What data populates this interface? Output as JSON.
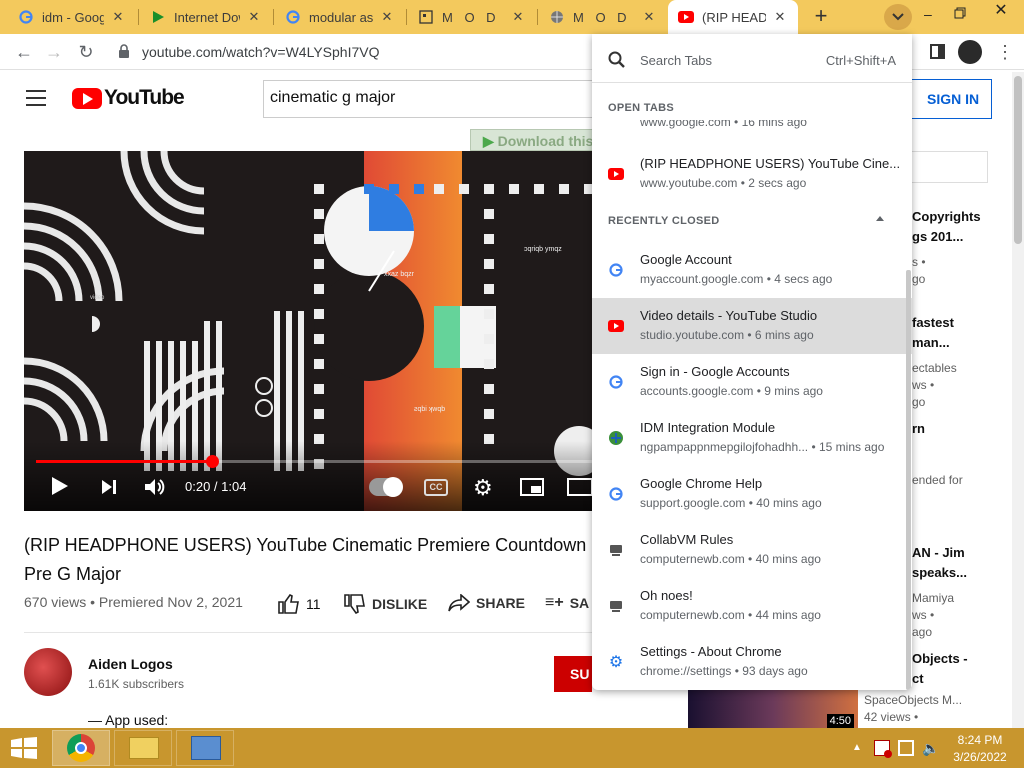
{
  "browser": {
    "tabs": [
      {
        "title": "idm - Googl",
        "icon": "google-icon"
      },
      {
        "title": "Internet Dow",
        "icon": "green-play-icon"
      },
      {
        "title": "modular ash",
        "icon": "google-icon"
      },
      {
        "title": "M O D U L A",
        "icon": "modular-icon"
      },
      {
        "title": "M O D U L A",
        "icon": "globe-icon"
      },
      {
        "title": "(RIP HEADPH",
        "icon": "youtube-icon"
      }
    ],
    "new_tab": "+",
    "url": "youtube.com/watch?v=W4LYSphI7VQ"
  },
  "youtube": {
    "logo": "YouTube",
    "search_value": "cinematic g major",
    "sign_in": "SIGN IN",
    "download_badge": "Download this",
    "player": {
      "time": "0:20 / 1:04",
      "progress": 0.31
    },
    "video_title": "(RIP HEADPHONE USERS) YouTube Cinematic Premiere Countdown Pre G Major",
    "views": "670 views • Premiered Nov 2, 2021",
    "likes": "11",
    "dislike": "DISLIKE",
    "share": "SHARE",
    "save": "SA",
    "channel": "Aiden Logos",
    "subscribers": "1.61K subscribers",
    "subscribe": "SU",
    "desc_line": "— App used:",
    "art_text": [
      "xxaz bqzr",
      "ƨqbi ʞwqb",
      "ɔqriqb ymqz"
    ]
  },
  "sidebar_recs": [
    {
      "lines": [
        "Copyrights",
        "gs 201..."
      ],
      "meta": [
        "s •",
        "go"
      ]
    },
    {
      "lines": [
        "fastest",
        "man..."
      ],
      "meta": [
        "ectables",
        "ws •",
        "go"
      ]
    },
    {
      "lines": [
        "rn"
      ],
      "meta": [
        "ended for"
      ]
    },
    {
      "lines": [
        "AN - Jim",
        "speaks..."
      ],
      "meta": [
        "Mamiya",
        "ws •",
        "ago"
      ]
    },
    {
      "lines": [
        "Objects -",
        "ct"
      ],
      "meta": [
        "SpaceObjects M...",
        "42 views •"
      ]
    }
  ],
  "thumb_duration": "4:50",
  "tab_search": {
    "placeholder": "Search Tabs",
    "shortcut": "Ctrl+Shift+A",
    "open_tabs_header": "OPEN TABS",
    "recently_closed_header": "RECENTLY CLOSED",
    "open_tabs": [
      {
        "title": "www.google.com • 16 mins ago",
        "url": "",
        "icon": "google-icon"
      },
      {
        "title": "(RIP HEADPHONE USERS) YouTube Cine...",
        "url": "www.youtube.com • 2 secs ago",
        "icon": "youtube-icon"
      }
    ],
    "recently_closed": [
      {
        "title": "Google Account",
        "url": "myaccount.google.com • 4 secs ago",
        "icon": "google-icon"
      },
      {
        "title": "Video details - YouTube Studio",
        "url": "studio.youtube.com • 6 mins ago",
        "icon": "youtube-icon"
      },
      {
        "title": "Sign in - Google Accounts",
        "url": "accounts.google.com • 9 mins ago",
        "icon": "google-icon"
      },
      {
        "title": "IDM Integration Module",
        "url": "ngpampappnmepgilojfohadhh... • 15 mins ago",
        "icon": "idm-icon"
      },
      {
        "title": "Google Chrome Help",
        "url": "support.google.com • 40 mins ago",
        "icon": "google-icon"
      },
      {
        "title": "CollabVM Rules",
        "url": "computernewb.com • 40 mins ago",
        "icon": "collabvm-icon"
      },
      {
        "title": "Oh noes!",
        "url": "computernewb.com • 44 mins ago",
        "icon": "collabvm-icon"
      },
      {
        "title": "Settings - About Chrome",
        "url": "chrome://settings • 93 days ago",
        "icon": "gear-icon"
      }
    ]
  },
  "taskbar": {
    "time": "8:24 PM",
    "date": "3/26/2022"
  }
}
